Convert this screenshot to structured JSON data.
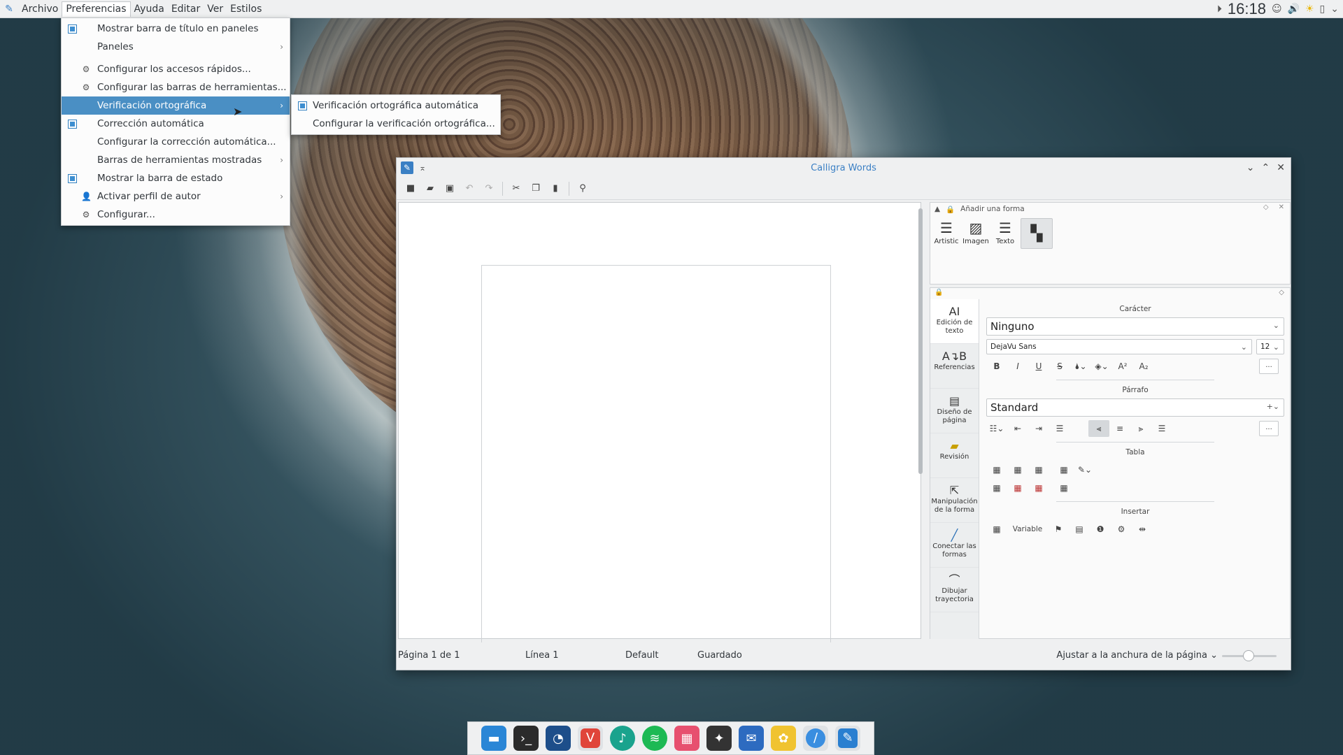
{
  "topbar": {
    "menus": [
      "Archivo",
      "Preferencias",
      "Ayuda",
      "Editar",
      "Ver",
      "Estilos"
    ],
    "active_menu": "Preferencias",
    "clock": "16:18",
    "tray_icons": [
      "media-play-icon",
      "notifications-icon",
      "volume-icon",
      "weather-icon",
      "battery-icon",
      "chevron-down-icon"
    ]
  },
  "prefs_menu": {
    "items": [
      {
        "label": "Mostrar barra de título en paneles",
        "check": true
      },
      {
        "label": "Paneles",
        "submenu": true
      },
      {
        "label": "Configurar los accesos rápidos...",
        "icon": "gear-icon",
        "sep": true
      },
      {
        "label": "Configurar las barras de herramientas...",
        "icon": "gear-icon"
      },
      {
        "label": "Verificación ortográfica",
        "submenu": true,
        "highlight": true
      },
      {
        "label": "Corrección automática",
        "check": true
      },
      {
        "label": "Configurar la corrección automática..."
      },
      {
        "label": "Barras de herramientas mostradas",
        "submenu": true
      },
      {
        "label": "Mostrar la barra de estado",
        "check": true
      },
      {
        "label": "Activar perfil de autor",
        "icon": "user-icon",
        "submenu": true
      },
      {
        "label": "Configurar...",
        "icon": "gear-icon"
      }
    ]
  },
  "spell_submenu": {
    "items": [
      {
        "label": "Verificación ortográfica automática",
        "check": true
      },
      {
        "label": "Configurar la verificación ortográfica..."
      }
    ]
  },
  "window": {
    "title": "Calligra Words"
  },
  "docker_shapes": {
    "title": "Añadir una forma",
    "shapes": [
      "Artistic",
      "Imagen",
      "Texto"
    ]
  },
  "tools": [
    {
      "label": "Edición de texto",
      "icon": "text-edit-icon"
    },
    {
      "label": "Referencias",
      "icon": "references-icon"
    },
    {
      "label": "Diseño de página",
      "icon": "page-layout-icon"
    },
    {
      "label": "Revisión",
      "icon": "review-icon"
    },
    {
      "label": "Manipulación de la forma",
      "icon": "pointer-icon"
    },
    {
      "label": "Conectar las formas",
      "icon": "connector-icon"
    },
    {
      "label": "Dibujar trayectoria",
      "icon": "path-icon"
    }
  ],
  "format_panel": {
    "caracter_title": "Carácter",
    "char_style": "Ninguno",
    "font": "DejaVu Sans",
    "size": "12",
    "parrafo_title": "Párrafo",
    "para_style": "Standard",
    "tabla_title": "Tabla",
    "insertar_title": "Insertar",
    "variable": "Variable",
    "more": "..."
  },
  "statusbar": {
    "page": "Página 1 de 1",
    "line": "Línea 1",
    "style": "Default",
    "saved": "Guardado",
    "zoom": "Ajustar a la anchura de la página"
  },
  "taskbar": [
    "files-icon",
    "terminal-icon",
    "browser-icon",
    "vivaldi-icon",
    "music-icon",
    "spotify-icon",
    "grid-app-icon",
    "inkscape-icon",
    "mail-icon",
    "photos-icon",
    "editor-icon",
    "calligra-icon"
  ]
}
